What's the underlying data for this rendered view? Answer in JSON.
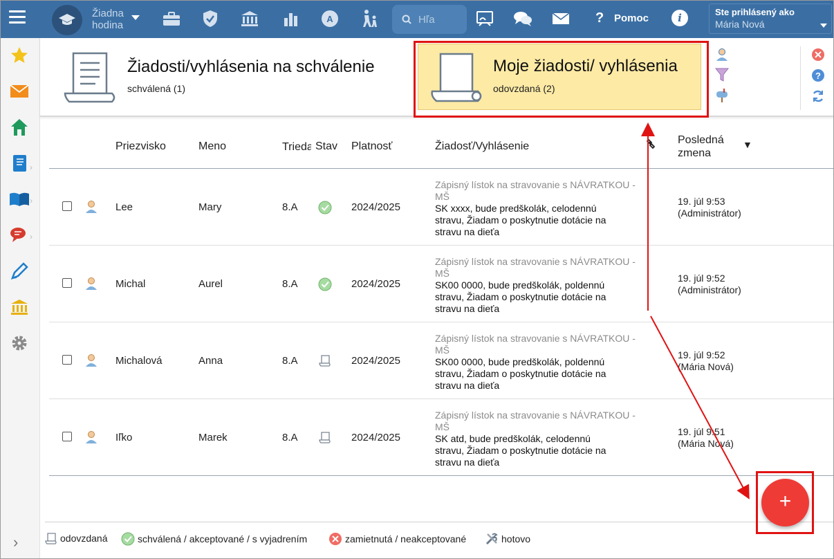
{
  "topbar": {
    "hour_line1": "Žiadna",
    "hour_line2": "hodina",
    "search_placeholder": "Hľa",
    "help_label": "Pomoc",
    "info_glyph": "i",
    "help_glyph": "?",
    "user_caption": "Ste prihlásený ako",
    "user_name": "Mária Nová",
    "icons": [
      "briefcase-icon",
      "shield-check-icon",
      "bank-icon",
      "bar-chart-icon",
      "award-icon",
      "walking-family-icon",
      "classroom-board-icon",
      "chat-bubbles-icon",
      "envelope-icon"
    ]
  },
  "sidebar": {
    "icons": [
      "star-icon",
      "envelope-icon",
      "home-icon",
      "notebook-icon",
      "open-book-icon",
      "chat-icon",
      "pen-icon",
      "institution-icon",
      "gear-icon"
    ],
    "expand_glyph": "›"
  },
  "header": {
    "approval_title": "Žiadosti/vyhlásenia na schválenie",
    "approval_sub": "schválená (1)",
    "my_title": "Moje žiadosti/ vyhlásenia",
    "my_sub": "odovzdaná (2)"
  },
  "table": {
    "columns": {
      "surname": "Priezvisko",
      "name": "Meno",
      "class": "Trieda",
      "state": "Stav",
      "validity": "Platnosť",
      "request": "Žiadosť/Vyhlásenie",
      "last_change_1": "Posledná",
      "last_change_2": "zmena",
      "sort_glyph": "▼"
    },
    "rows": [
      {
        "surname": "Lee",
        "name": "Mary",
        "class": "8.A",
        "state": "approved",
        "validity": "2024/2025",
        "req_type_1": "Zápisný lístok na stravovanie s NÁVRATKOU -",
        "req_type_2": "MŠ",
        "req_1": "SK xxxx, bude predškolák, celodennú",
        "req_2": "stravu, Žiadam o poskytnutie dotácie na",
        "req_3": "stravu na dieťa",
        "when_1": "19. júl 9:53",
        "when_2": "(Administrátor)"
      },
      {
        "surname": "Michal",
        "name": "Aurel",
        "class": "8.A",
        "state": "approved",
        "validity": "2024/2025",
        "req_type_1": "Zápisný lístok na stravovanie s NÁVRATKOU -",
        "req_type_2": "MŠ",
        "req_1": "SK00 0000, bude predškolák, poldennú",
        "req_2": "stravu, Žiadam o poskytnutie dotácie na",
        "req_3": "stravu na dieťa",
        "when_1": "19. júl 9:52",
        "when_2": "(Administrátor)"
      },
      {
        "surname": "Michalová",
        "name": "Anna",
        "class": "8.A",
        "state": "submitted",
        "validity": "2024/2025",
        "req_type_1": "Zápisný lístok na stravovanie s NÁVRATKOU -",
        "req_type_2": "MŠ",
        "req_1": "SK00 0000, bude predškolák, poldennú",
        "req_2": "stravu, Žiadam o poskytnutie dotácie na",
        "req_3": "stravu na dieťa",
        "when_1": "19. júl 9:52",
        "when_2": "(Mária Nová)"
      },
      {
        "surname": "Iľko",
        "name": "Marek",
        "class": "8.A",
        "state": "submitted",
        "validity": "2024/2025",
        "req_type_1": "Zápisný lístok na stravovanie s NÁVRATKOU -",
        "req_type_2": "MŠ",
        "req_1": "SK atd, bude predškolák, celodennú",
        "req_2": "stravu, Žiadam o poskytnutie dotácie na",
        "req_3": "stravu na dieťa",
        "when_1": "19. júl 9:51",
        "when_2": "(Mária Nová)"
      }
    ]
  },
  "legend": {
    "submitted": "odovzdaná",
    "approved": "schválená / akceptované / s vyjadrením",
    "rejected": "zamietnutá / neakceptované",
    "done": "hotovo"
  },
  "fab": {
    "glyph": "+"
  },
  "colors": {
    "topbar": "#3b6fa4",
    "highlight_panel": "#fdeaa5",
    "annotation_red": "#e01313",
    "fab_red": "#ef3b36",
    "approved_green": "#8fcf8a"
  }
}
